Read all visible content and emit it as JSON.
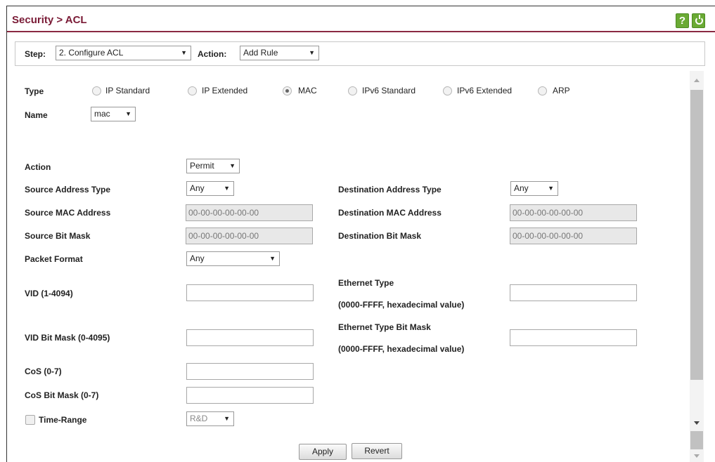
{
  "header": {
    "title": "Security > ACL",
    "help_icon": "?"
  },
  "step": {
    "label": "Step:",
    "value": "2. Configure ACL",
    "action_label": "Action:",
    "action_value": "Add Rule"
  },
  "type": {
    "label": "Type",
    "options": [
      "IP Standard",
      "IP Extended",
      "MAC",
      "IPv6 Standard",
      "IPv6 Extended",
      "ARP"
    ],
    "selected": "MAC"
  },
  "name": {
    "label": "Name",
    "value": "mac"
  },
  "form": {
    "action_label": "Action",
    "action_value": "Permit",
    "src_addr_type_label": "Source Address Type",
    "src_addr_type_value": "Any",
    "dst_addr_type_label": "Destination Address Type",
    "dst_addr_type_value": "Any",
    "src_mac_label": "Source MAC Address",
    "src_mac_value": "00-00-00-00-00-00",
    "dst_mac_label": "Destination MAC Address",
    "dst_mac_value": "00-00-00-00-00-00",
    "src_mask_label": "Source Bit Mask",
    "src_mask_value": "00-00-00-00-00-00",
    "dst_mask_label": "Destination Bit Mask",
    "dst_mask_value": "00-00-00-00-00-00",
    "packet_format_label": "Packet Format",
    "packet_format_value": "Any",
    "vid_label": "VID (1-4094)",
    "vid_value": "",
    "eth_type_label": "Ethernet Type",
    "eth_type_hint": "(0000-FFFF, hexadecimal value)",
    "eth_type_value": "",
    "vid_mask_label": "VID Bit Mask (0-4095)",
    "vid_mask_value": "",
    "eth_type_mask_label": "Ethernet Type Bit Mask",
    "eth_type_mask_hint": "(0000-FFFF, hexadecimal value)",
    "eth_type_mask_value": "",
    "cos_label": "CoS (0-7)",
    "cos_value": "",
    "cos_mask_label": "CoS Bit Mask (0-7)",
    "cos_mask_value": "",
    "time_range_label": "Time-Range",
    "time_range_value": "R&D"
  },
  "buttons": {
    "apply": "Apply",
    "revert": "Revert"
  },
  "colors": {
    "title": "#7a1b36",
    "accent_green": "#6aaa34"
  }
}
